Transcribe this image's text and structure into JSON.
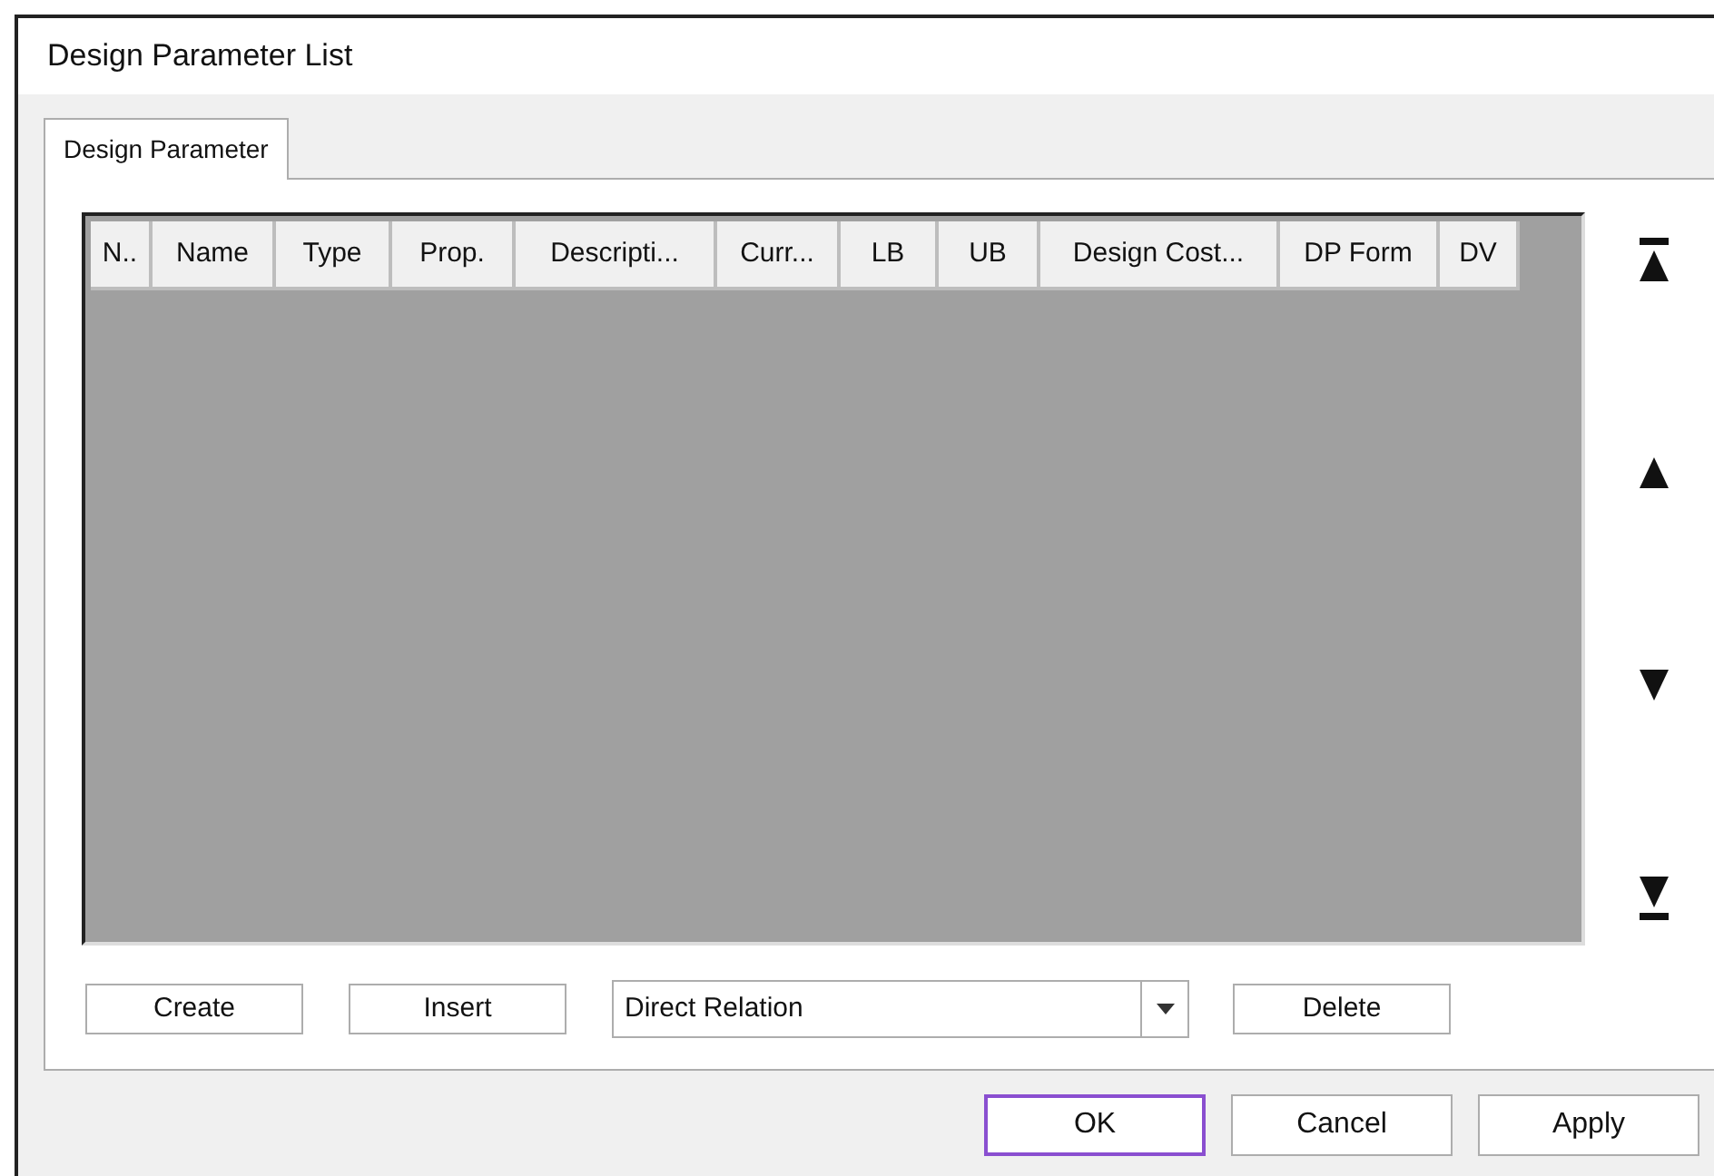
{
  "window": {
    "title": "Design Parameter List"
  },
  "tabs": [
    {
      "label": "Design Parameter",
      "selected": true
    }
  ],
  "table": {
    "columns": [
      "N..",
      "Name",
      "Type",
      "Prop.",
      "Descripti...",
      "Curr...",
      "LB",
      "UB",
      "Design Cost...",
      "DP Form",
      "DV"
    ]
  },
  "panel_buttons": [
    {
      "kind": "button",
      "label": "Create"
    },
    {
      "kind": "button",
      "label": "Insert"
    },
    {
      "kind": "dropdown",
      "label": "Direct Relation"
    },
    {
      "kind": "button",
      "label": "Delete"
    }
  ],
  "dialog_buttons": [
    {
      "label": "OK",
      "focused": true
    },
    {
      "label": "Cancel",
      "focused": false
    },
    {
      "label": "Apply",
      "focused": false
    }
  ]
}
